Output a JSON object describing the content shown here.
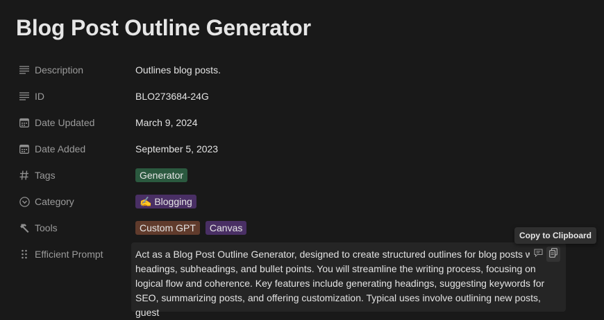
{
  "page": {
    "title": "Blog Post Outline Generator"
  },
  "properties": [
    {
      "label": "Description",
      "icon": "text-lines-icon",
      "value": "Outlines blog posts."
    },
    {
      "label": "ID",
      "icon": "text-lines-icon",
      "value": "BLO273684-24G"
    },
    {
      "label": "Date Updated",
      "icon": "calendar-icon",
      "value": "March 9, 2024"
    },
    {
      "label": "Date Added",
      "icon": "calendar-icon",
      "value": "September 5, 2023"
    },
    {
      "label": "Tags",
      "icon": "hash-icon",
      "tags": [
        "Generator"
      ]
    },
    {
      "label": "Category",
      "icon": "circle-chevron-icon",
      "tags": [
        "✍️ Blogging"
      ]
    },
    {
      "label": "Tools",
      "icon": "hammer-icon",
      "tags": [
        "Custom GPT",
        "Canvas"
      ]
    }
  ],
  "prompt": {
    "label": "Efficient Prompt",
    "icon": "drag-handle-icon",
    "text": "Act as a Blog Post Outline Generator, designed to create structured outlines for blog posts with headings, subheadings, and bullet points. You will streamline the writing process, focusing on logical flow and coherence. Key features include generating headings, suggesting keywords for SEO, summarizing posts, and offering customization. Typical uses involve outlining new posts, guest",
    "tooltip": "Copy to Clipboard"
  },
  "colors": {
    "background": "#191919",
    "tag_green": "#2b593f",
    "tag_purple": "#492f64",
    "tag_brown": "#603b2c"
  }
}
